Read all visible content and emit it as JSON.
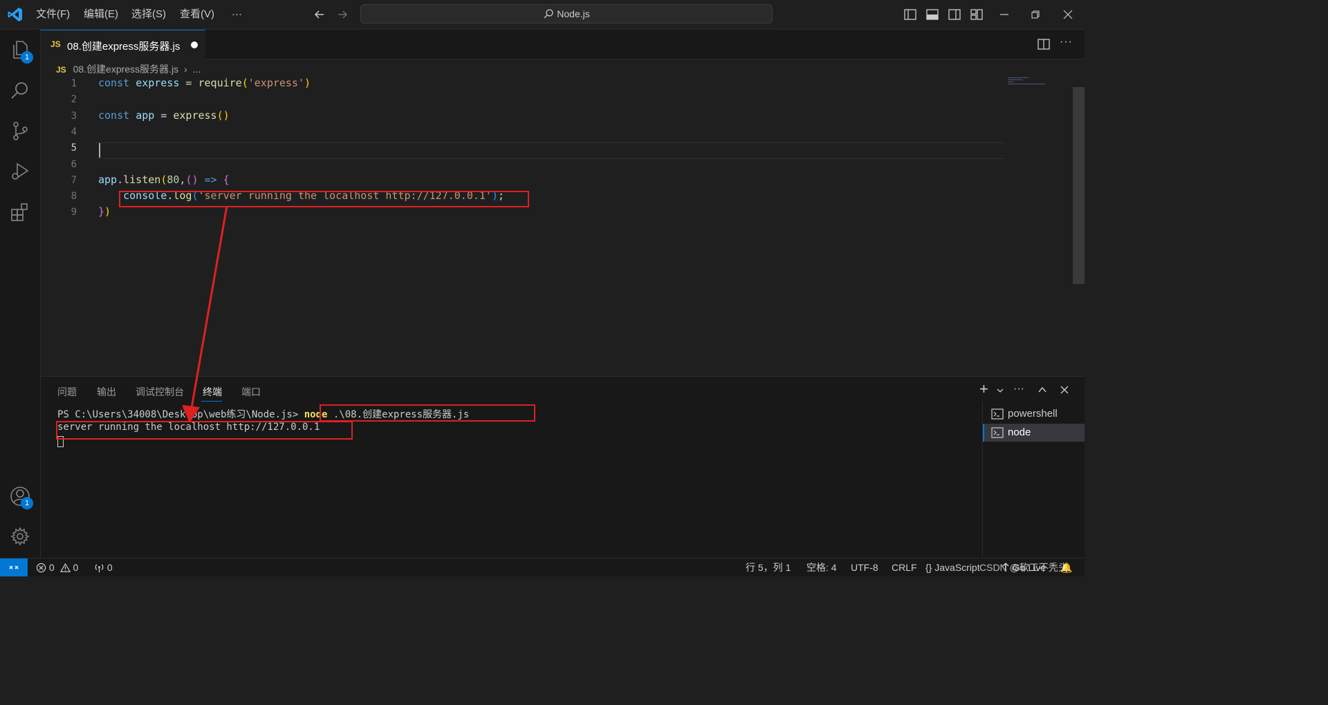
{
  "titlebar": {
    "menus": [
      "文件(F)",
      "编辑(E)",
      "选择(S)",
      "查看(V)",
      "···"
    ],
    "search_text": "Node.js"
  },
  "activity": {
    "explorer_badge": "1",
    "account_badge": "1"
  },
  "tab": {
    "filename": "08.创建express服务器.js",
    "lang_badge": "JS"
  },
  "breadcrumb": {
    "file": "08.创建express服务器.js",
    "sep": "›",
    "more": "..."
  },
  "editor": {
    "line_numbers": [
      "1",
      "2",
      "3",
      "4",
      "5",
      "6",
      "7",
      "8",
      "9"
    ],
    "lines": [
      [
        [
          "kw",
          "const "
        ],
        [
          "vr",
          "express"
        ],
        [
          "pn",
          " = "
        ],
        [
          "fn",
          "require"
        ],
        [
          "br",
          "("
        ],
        [
          "st",
          "'express'"
        ],
        [
          "br",
          ")"
        ]
      ],
      [],
      [
        [
          "kw",
          "const "
        ],
        [
          "vr",
          "app"
        ],
        [
          "pn",
          " = "
        ],
        [
          "fn",
          "express"
        ],
        [
          "br",
          "()"
        ]
      ],
      [],
      [],
      [],
      [
        [
          "vr",
          "app"
        ],
        [
          "pn",
          "."
        ],
        [
          "fn",
          "listen"
        ],
        [
          "br",
          "("
        ],
        [
          "nm",
          "80"
        ],
        [
          "pn",
          ","
        ],
        [
          "br2",
          "()"
        ],
        [
          "kw",
          " => "
        ],
        [
          "br2",
          "{"
        ]
      ],
      [
        [
          "pn",
          "    "
        ],
        [
          "vr",
          "console"
        ],
        [
          "pn",
          "."
        ],
        [
          "fn",
          "log"
        ],
        [
          "br3",
          "("
        ],
        [
          "st",
          "'server running the localhost http://127.0.0.1'"
        ],
        [
          "br3",
          ")"
        ],
        [
          "pn",
          ";"
        ]
      ],
      [
        [
          "br2",
          "}"
        ],
        [
          "br",
          ")"
        ]
      ]
    ]
  },
  "panel": {
    "tabs": [
      "问题",
      "输出",
      "调试控制台",
      "终端",
      "端口"
    ],
    "active_tab": "终端",
    "terminal": {
      "prompt": "PS C:\\Users\\34008\\Desktop\\web练习\\Node.js> ",
      "command_keyword": "node",
      "command_rest": " .\\08.创建express服务器.js",
      "output": "server running the localhost http://127.0.0.1"
    },
    "sessions": [
      "powershell",
      "node"
    ],
    "active_session": "node"
  },
  "statusbar": {
    "errors": "0",
    "warnings": "0",
    "ports": "0",
    "position": "行 5，列 1",
    "spaces": "空格: 4",
    "encoding": "UTF-8",
    "eol": "CRLF",
    "language": "JavaScript",
    "go_live": "Go Live"
  },
  "watermark": "CSDN @软工不秃头"
}
